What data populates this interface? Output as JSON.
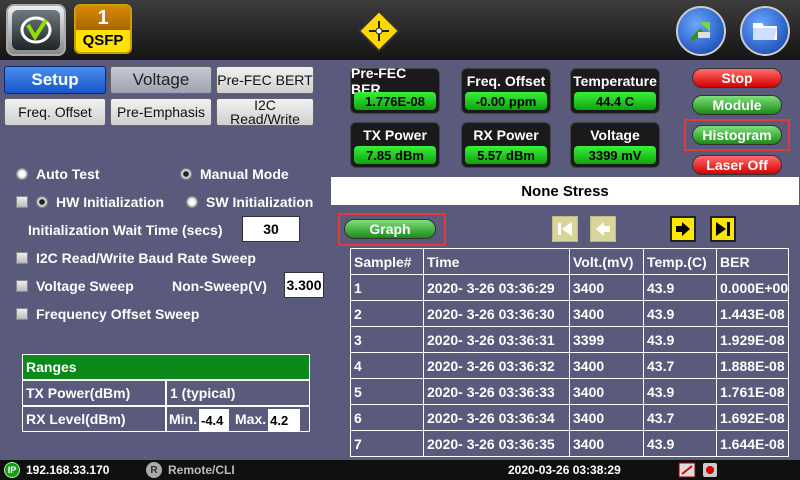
{
  "header": {
    "module_number": "1",
    "module_type": "QSFP"
  },
  "tabs": [
    {
      "label": "Setup",
      "state": "active"
    },
    {
      "label": "Voltage",
      "state": "greyed"
    },
    {
      "label": "Pre-FEC BERT",
      "state": "normal"
    },
    {
      "label": "Freq. Offset",
      "state": "normal"
    },
    {
      "label": "Pre-Emphasis",
      "state": "normal"
    },
    {
      "label": "I2C Read/Write",
      "state": "normal"
    }
  ],
  "setup": {
    "auto_test": "Auto Test",
    "manual_mode": "Manual Mode",
    "hw_init": "HW Initialization",
    "sw_init": "SW Initialization",
    "init_wait_label": "Initialization Wait Time (secs)",
    "init_wait_value": "30",
    "i2c_sweep": "I2C Read/Write Baud Rate Sweep",
    "voltage_sweep": "Voltage Sweep",
    "non_sweep_label": "Non-Sweep(V)",
    "non_sweep_value": "3.300",
    "freq_sweep": "Frequency Offset Sweep"
  },
  "ranges": {
    "title": "Ranges",
    "tx_label": "TX Power(dBm)",
    "tx_value": "1 (typical)",
    "rx_label": "RX Level(dBm)",
    "min_label": "Min.",
    "min_value": "-4.4",
    "max_label": "Max.",
    "max_value": "4.2"
  },
  "metrics": [
    {
      "title": "Pre-FEC BER",
      "value": "1.776E-08"
    },
    {
      "title": "Freq. Offset",
      "value": "-0.00 ppm"
    },
    {
      "title": "Temperature",
      "value": "44.4 C"
    },
    {
      "title": "TX Power",
      "value": "7.85 dBm"
    },
    {
      "title": "RX Power",
      "value": "5.57 dBm"
    },
    {
      "title": "Voltage",
      "value": "3399 mV"
    }
  ],
  "actions": {
    "stop": "Stop",
    "module": "Module",
    "histogram": "Histogram",
    "laser_off": "Laser Off"
  },
  "stress": "None Stress",
  "graph_label": "Graph",
  "table": {
    "headers": [
      "Sample#",
      "Time",
      "Volt.(mV)",
      "Temp.(C)",
      "BER"
    ],
    "rows": [
      [
        "1",
        "2020- 3-26 03:36:29",
        "3400",
        "43.9",
        "0.000E+00"
      ],
      [
        "2",
        "2020- 3-26 03:36:30",
        "3400",
        "43.9",
        "1.443E-08"
      ],
      [
        "3",
        "2020- 3-26 03:36:31",
        "3399",
        "43.9",
        "1.929E-08"
      ],
      [
        "4",
        "2020- 3-26 03:36:32",
        "3400",
        "43.7",
        "1.888E-08"
      ],
      [
        "5",
        "2020- 3-26 03:36:33",
        "3400",
        "43.9",
        "1.761E-08"
      ],
      [
        "6",
        "2020- 3-26 03:36:34",
        "3400",
        "43.7",
        "1.692E-08"
      ],
      [
        "7",
        "2020- 3-26 03:36:35",
        "3400",
        "43.9",
        "1.644E-08"
      ]
    ]
  },
  "status": {
    "ip_badge": "IP",
    "ip": "192.168.33.170",
    "remote_badge": "R",
    "remote": "Remote/CLI",
    "datetime": "2020-03-26  03:38:29"
  }
}
